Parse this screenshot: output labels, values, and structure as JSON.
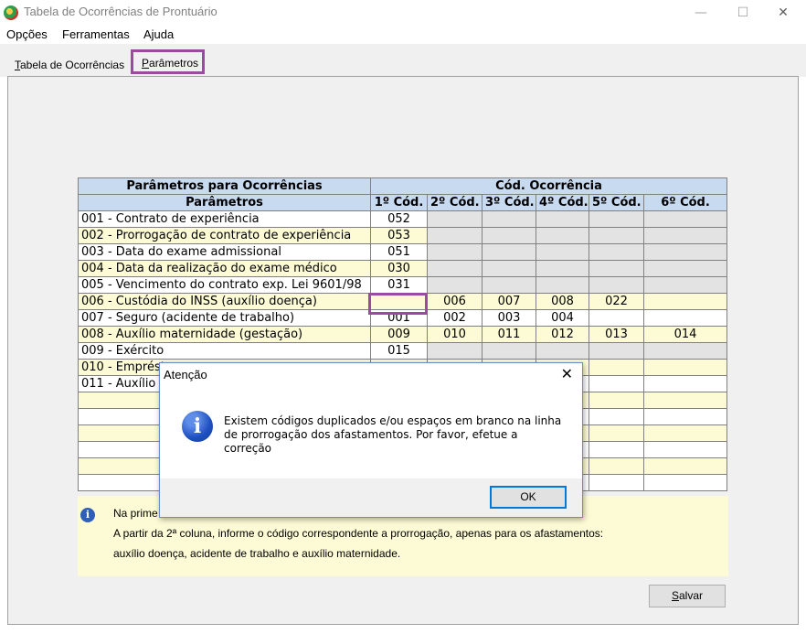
{
  "window": {
    "title": "Tabela de Ocorrências de Prontuário",
    "minimize": "—",
    "maximize": "☐",
    "close": "✕"
  },
  "menu": [
    "Opções",
    "Ferramentas",
    "Ajuda"
  ],
  "tabs": [
    {
      "label_underlined": "T",
      "label_rest": "abela de Ocorrências"
    },
    {
      "label_underlined": "P",
      "label_rest": "arâmetros"
    }
  ],
  "table": {
    "group_headers": [
      "Parâmetros para Ocorrências",
      "Cód. Ocorrência"
    ],
    "columns": [
      "Parâmetros",
      "1º Cód.",
      "2º Cód.",
      "3º Cód.",
      "4º Cód.",
      "5º Cód.",
      "6º Cód."
    ],
    "rows": [
      {
        "label": "001 - Contrato de experiência",
        "codes": [
          "052",
          "",
          "",
          "",
          "",
          ""
        ]
      },
      {
        "label": "002 - Prorrogação de contrato de experiência",
        "codes": [
          "053",
          "",
          "",
          "",
          "",
          ""
        ]
      },
      {
        "label": "003 - Data do exame admissional",
        "codes": [
          "051",
          "",
          "",
          "",
          "",
          ""
        ]
      },
      {
        "label": "004 - Data da realização do exame médico",
        "codes": [
          "030",
          "",
          "",
          "",
          "",
          ""
        ]
      },
      {
        "label": "005 - Vencimento do contrato exp. Lei 9601/98",
        "codes": [
          "031",
          "",
          "",
          "",
          "",
          ""
        ]
      },
      {
        "label": "006 - Custódia do INSS (auxílio doença)",
        "codes": [
          "",
          "006",
          "007",
          "008",
          "022",
          ""
        ]
      },
      {
        "label": "007 - Seguro (acidente de trabalho)",
        "codes": [
          "001",
          "002",
          "003",
          "004",
          "",
          ""
        ]
      },
      {
        "label": "008 - Auxílio maternidade (gestação)",
        "codes": [
          "009",
          "010",
          "011",
          "012",
          "013",
          "014"
        ]
      },
      {
        "label": "009 - Exército",
        "codes": [
          "015",
          "",
          "",
          "",
          "",
          ""
        ]
      },
      {
        "label": "010 - Emprést",
        "codes": [
          "",
          "",
          "",
          "",
          "",
          ""
        ]
      },
      {
        "label": "011 - Auxílio r",
        "codes": [
          "",
          "",
          "",
          "",
          "",
          ""
        ]
      },
      {
        "label": "",
        "codes": [
          "",
          "",
          "",
          "",
          "",
          ""
        ]
      },
      {
        "label": "",
        "codes": [
          "",
          "",
          "",
          "",
          "",
          ""
        ]
      },
      {
        "label": "",
        "codes": [
          "",
          "",
          "",
          "",
          "",
          ""
        ]
      },
      {
        "label": "",
        "codes": [
          "",
          "",
          "",
          "",
          "",
          ""
        ]
      },
      {
        "label": "",
        "codes": [
          "",
          "",
          "",
          "",
          "",
          ""
        ]
      },
      {
        "label": "",
        "codes": [
          "",
          "",
          "",
          "",
          "",
          ""
        ]
      }
    ]
  },
  "info": {
    "icon": "i",
    "lines": [
      "Na prime",
      "A partir da 2ª coluna, informe o código correspondente a prorrogação, apenas para os afastamentos:",
      "auxílio doença, acidente de trabalho e auxílio maternidade."
    ]
  },
  "save_button": {
    "underlined": "S",
    "rest": "alvar"
  },
  "dialog": {
    "title": "Atenção",
    "close": "✕",
    "icon": "i",
    "message": "Existem códigos duplicados e/ou espaços em branco na linha de prorrogação dos afastamentos. Por favor, efetue a correção",
    "ok_label": "OK"
  },
  "colors": {
    "header_bg": "#c8daf0",
    "row_alt_bg": "#fdfbd5",
    "highlight": "#9b4b9f",
    "inactive_cell": "#e3e3e3"
  }
}
